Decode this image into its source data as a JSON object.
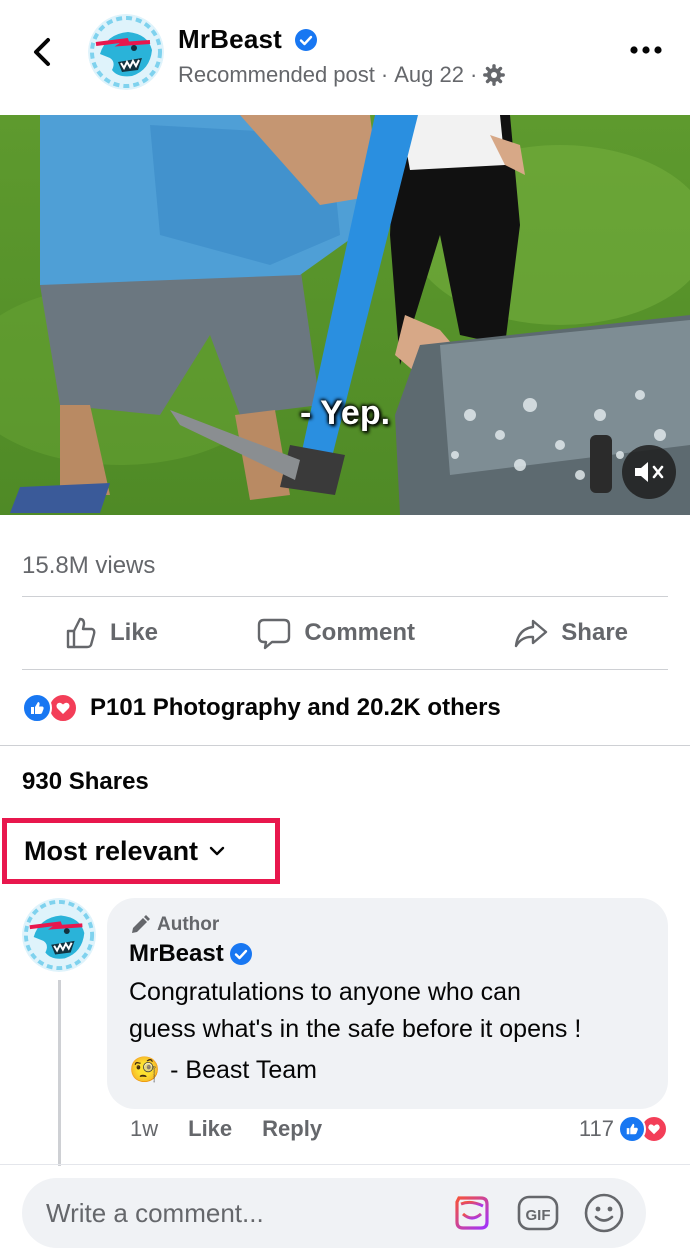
{
  "header": {
    "page_name": "MrBeast",
    "meta_label": "Recommended post",
    "separator": "·",
    "date": "Aug 22",
    "icons": [
      "back-arrow-icon",
      "verified-badge-icon",
      "gear-icon",
      "more-dots-icon"
    ]
  },
  "video": {
    "caption": "- Yep.",
    "mute_icon": "volume-muted-icon"
  },
  "stats": {
    "views": "15.8M views",
    "reactions_text": "P101 Photography and 20.2K others",
    "shares": "930 Shares"
  },
  "actions": {
    "like": "Like",
    "comment": "Comment",
    "share": "Share"
  },
  "sort": {
    "label": "Most relevant",
    "highlight_color": "#e8174d"
  },
  "comment": {
    "badge": "Author",
    "name": "MrBeast",
    "text": "Congratulations to anyone who can\nguess what's in the safe before it opens !",
    "emoji": "🧐",
    "signature": "- Beast Team",
    "time": "1w",
    "like_label": "Like",
    "reply_label": "Reply",
    "reaction_count": "117"
  },
  "composer": {
    "placeholder": "Write a comment...",
    "icons": [
      "avatar-sticker-icon",
      "gif-icon",
      "emoji-icon"
    ]
  },
  "colors": {
    "brand_blue": "#1877f2",
    "love_red": "#f33e58",
    "muted_text": "#65676b"
  }
}
